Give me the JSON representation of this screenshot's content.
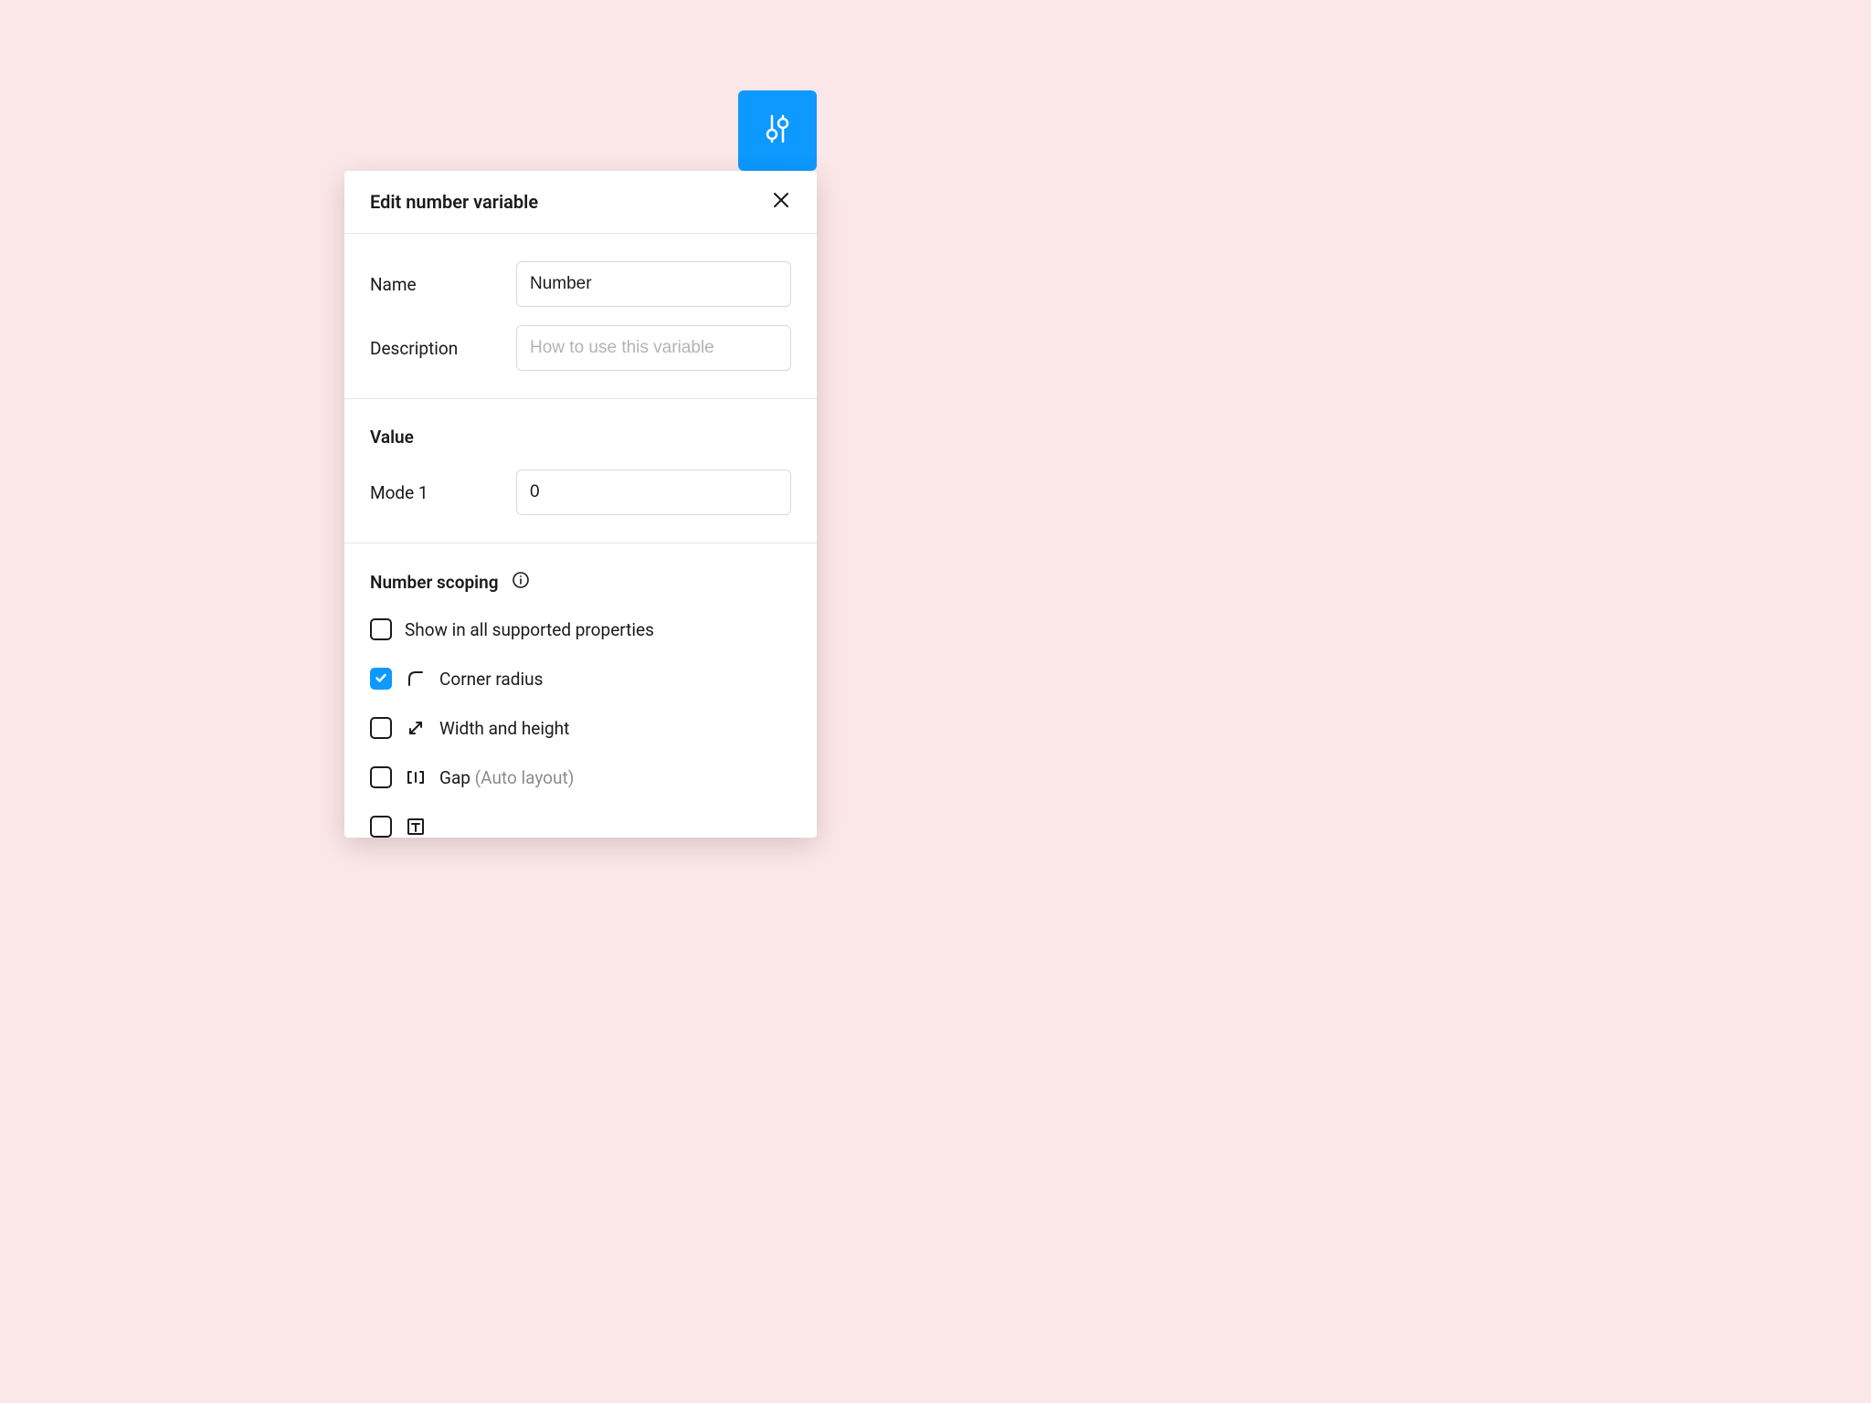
{
  "panel": {
    "title": "Edit number variable",
    "name_label": "Name",
    "name_value": "Number",
    "description_label": "Description",
    "description_placeholder": "How to use this variable",
    "value_title": "Value",
    "mode_label": "Mode 1",
    "mode_value": "0",
    "scoping_title": "Number scoping",
    "scopes": {
      "all": {
        "label": "Show in all supported properties",
        "checked": false
      },
      "corner_radius": {
        "label": "Corner radius",
        "checked": true
      },
      "width_height": {
        "label": "Width and height",
        "checked": false
      },
      "gap": {
        "label": "Gap",
        "suffix": " (Auto layout)",
        "checked": false
      }
    }
  }
}
